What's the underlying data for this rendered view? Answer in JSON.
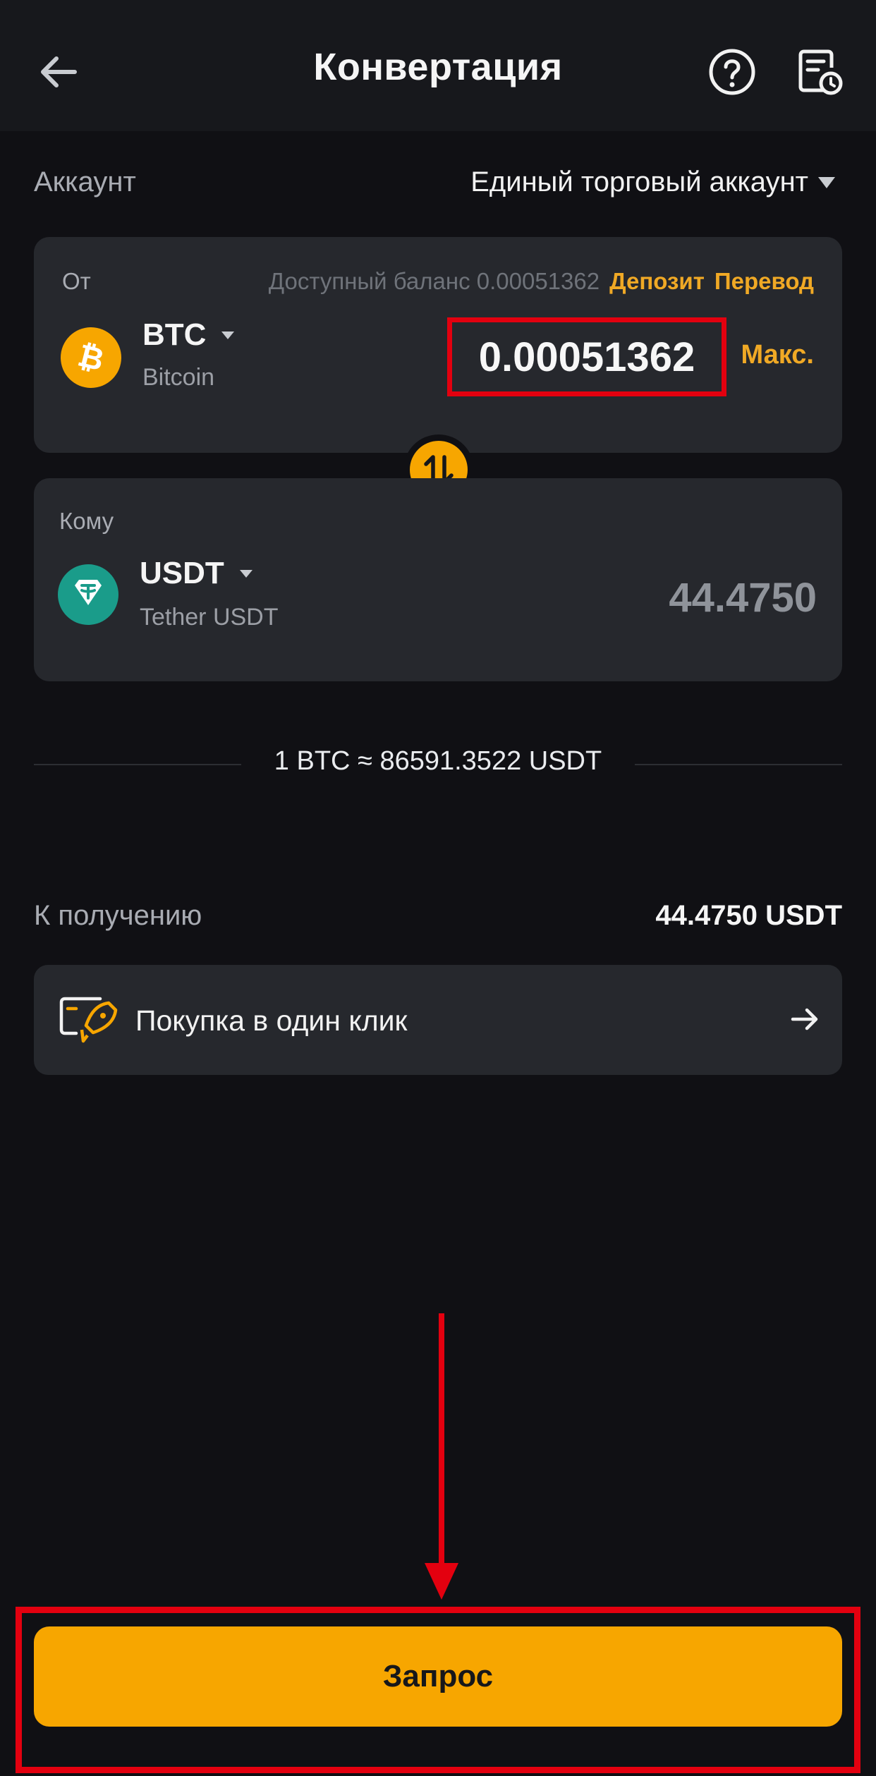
{
  "header": {
    "title": "Конвертация",
    "icons": [
      "back-arrow-icon",
      "help-icon",
      "history-icon"
    ]
  },
  "account": {
    "label": "Аккаунт",
    "value": "Единый торговый аккаунт"
  },
  "from": {
    "label": "От",
    "balance_text": "Доступный баланс 0.00051362",
    "deposit_label": "Депозит",
    "transfer_label": "Перевод",
    "coin_symbol": "BTC",
    "coin_name": "Bitcoin",
    "amount": "0.00051362",
    "max_label": "Макс."
  },
  "to": {
    "label": "Кому",
    "coin_symbol": "USDT",
    "coin_name": "Tether USDT",
    "amount": "44.4750"
  },
  "rate": {
    "text": "1 BTC ≈ 86591.3522 USDT"
  },
  "receive": {
    "label": "К получению",
    "value": "44.4750 USDT"
  },
  "one_click": {
    "label": "Покупка в один клик"
  },
  "submit": {
    "label": "Запрос"
  },
  "colors": {
    "accent": "#f7a600",
    "highlight": "#e3000f",
    "background": "#101014",
    "card": "#26282d"
  }
}
